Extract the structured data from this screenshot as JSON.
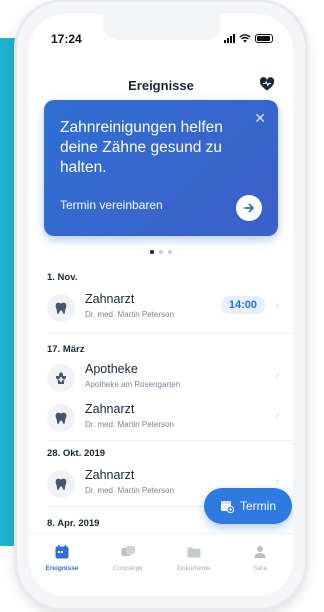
{
  "status_bar": {
    "time": "17:24"
  },
  "header": {
    "title": "Ereignisse"
  },
  "banner": {
    "text": "Zahnreinigungen helfen deine Zähne gesund zu halten.",
    "action_label": "Termin vereinbaren"
  },
  "carousel": {
    "page_count": 3,
    "active_index": 0
  },
  "events": [
    {
      "date": "1. Nov.",
      "title": "Zahnarzt",
      "subtitle": "Dr. med. Martin Peterson",
      "time": "14:00",
      "icon": "tooth-icon"
    },
    {
      "date": "17. März",
      "title": "Apotheke",
      "subtitle": "Apotheke am Rosengarten",
      "icon": "pharmacy-icon"
    },
    {
      "date": "",
      "title": "Zahnarzt",
      "subtitle": "Dr. med. Martin Peterson",
      "icon": "tooth-icon"
    },
    {
      "date": "28. Okt. 2019",
      "title": "Zahnarzt",
      "subtitle": "Dr. med. Martin Peterson",
      "icon": "tooth-icon"
    }
  ],
  "last_date": "8. Apr. 2019",
  "fab": {
    "label": "Termin"
  },
  "tabbar": {
    "items": [
      {
        "label": "Ereignisse",
        "icon": "calendar-icon",
        "active": true
      },
      {
        "label": "Concierge",
        "icon": "concierge-icon",
        "active": false
      },
      {
        "label": "Dokumente",
        "icon": "folder-icon",
        "active": false
      },
      {
        "label": "Sara",
        "icon": "person-icon",
        "active": false
      }
    ]
  },
  "colors": {
    "accent": "#2f6fd2",
    "teal": "#1fb2cf",
    "text": "#1b2637"
  }
}
